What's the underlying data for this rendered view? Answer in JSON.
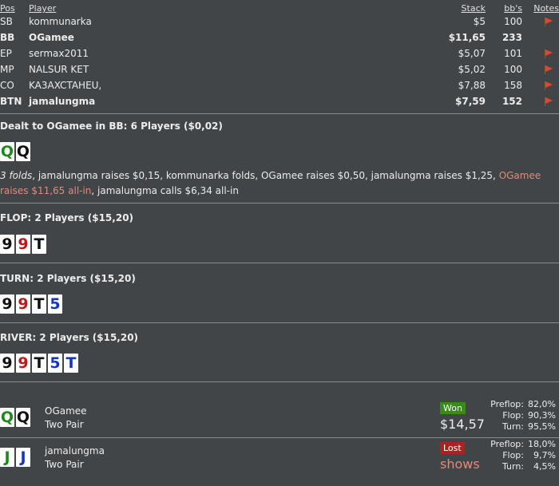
{
  "headers": {
    "pos": "Pos",
    "player": "Player",
    "stack": "Stack",
    "bb": "bb's",
    "notes": "Notes"
  },
  "players": [
    {
      "pos": "SB",
      "name": "kommunarka",
      "stack": "$5",
      "bb": "100",
      "bold": false,
      "flag": true
    },
    {
      "pos": "BB",
      "name": "OGamee",
      "stack": "$11,65",
      "bb": "233",
      "bold": true,
      "flag": false
    },
    {
      "pos": "EP",
      "name": "sermax2011",
      "stack": "$5,07",
      "bb": "101",
      "bold": false,
      "flag": true
    },
    {
      "pos": "MP",
      "name": "NALSUR KET",
      "stack": "$5,02",
      "bb": "100",
      "bold": false,
      "flag": true
    },
    {
      "pos": "CO",
      "name": "KA3AXCTAHEU,",
      "stack": "$7,88",
      "bb": "158",
      "bold": false,
      "flag": true
    },
    {
      "pos": "BTN",
      "name": "jamalungma",
      "stack": "$7,59",
      "bb": "152",
      "bold": true,
      "flag": true
    }
  ],
  "preflop": {
    "title": "Dealt to OGamee in BB: 6 Players ($0,02)",
    "cards": [
      {
        "rank": "Q",
        "suit": "club"
      },
      {
        "rank": "Q",
        "suit": "spade"
      }
    ],
    "action": {
      "folds": "3 folds",
      "text1": ", jamalungma raises $0,15, kommunarka folds, OGamee raises $0,50, jamalungma raises $1,25, ",
      "red": "OGamee raises $11,65 all-in",
      "text2": ", jamalungma calls $6,34 all-in"
    }
  },
  "flop": {
    "title": "FLOP: 2 Players ($15,20)",
    "cards": [
      {
        "rank": "9",
        "suit": "spade"
      },
      {
        "rank": "9",
        "suit": "heart"
      },
      {
        "rank": "T",
        "suit": "spade"
      }
    ]
  },
  "turn": {
    "title": "TURN: 2 Players ($15,20)",
    "cards": [
      {
        "rank": "9",
        "suit": "spade"
      },
      {
        "rank": "9",
        "suit": "heart"
      },
      {
        "rank": "T",
        "suit": "spade"
      },
      {
        "rank": "5",
        "suit": "diamond"
      }
    ]
  },
  "river": {
    "title": "RIVER: 2 Players ($15,20)",
    "cards": [
      {
        "rank": "9",
        "suit": "spade"
      },
      {
        "rank": "9",
        "suit": "heart"
      },
      {
        "rank": "T",
        "suit": "spade"
      },
      {
        "rank": "5",
        "suit": "diamond"
      },
      {
        "rank": "T",
        "suit": "diamond"
      }
    ]
  },
  "results": [
    {
      "name": "OGamee",
      "hand": "Two Pair",
      "cards": [
        {
          "rank": "Q",
          "suit": "club"
        },
        {
          "rank": "Q",
          "suit": "spade"
        }
      ],
      "badge": "Won",
      "amount": "$14,57",
      "equity": [
        {
          "label": "Preflop:",
          "value": "82,0%"
        },
        {
          "label": "Flop:",
          "value": "90,3%"
        },
        {
          "label": "Turn:",
          "value": "95,5%"
        }
      ]
    },
    {
      "name": "jamalungma",
      "hand": "Two Pair",
      "cards": [
        {
          "rank": "J",
          "suit": "club"
        },
        {
          "rank": "J",
          "suit": "diamond"
        }
      ],
      "badge": "Lost",
      "amount": "shows",
      "equity": [
        {
          "label": "Preflop:",
          "value": "18,0%"
        },
        {
          "label": "Flop:",
          "value": "9,7%"
        },
        {
          "label": "Turn:",
          "value": "4,5%"
        }
      ]
    }
  ],
  "colors": {
    "background": "#424548",
    "won": "#3a8a1a",
    "lost": "#b02020",
    "highlight": "#e08b7a",
    "flag": "#e04828"
  }
}
